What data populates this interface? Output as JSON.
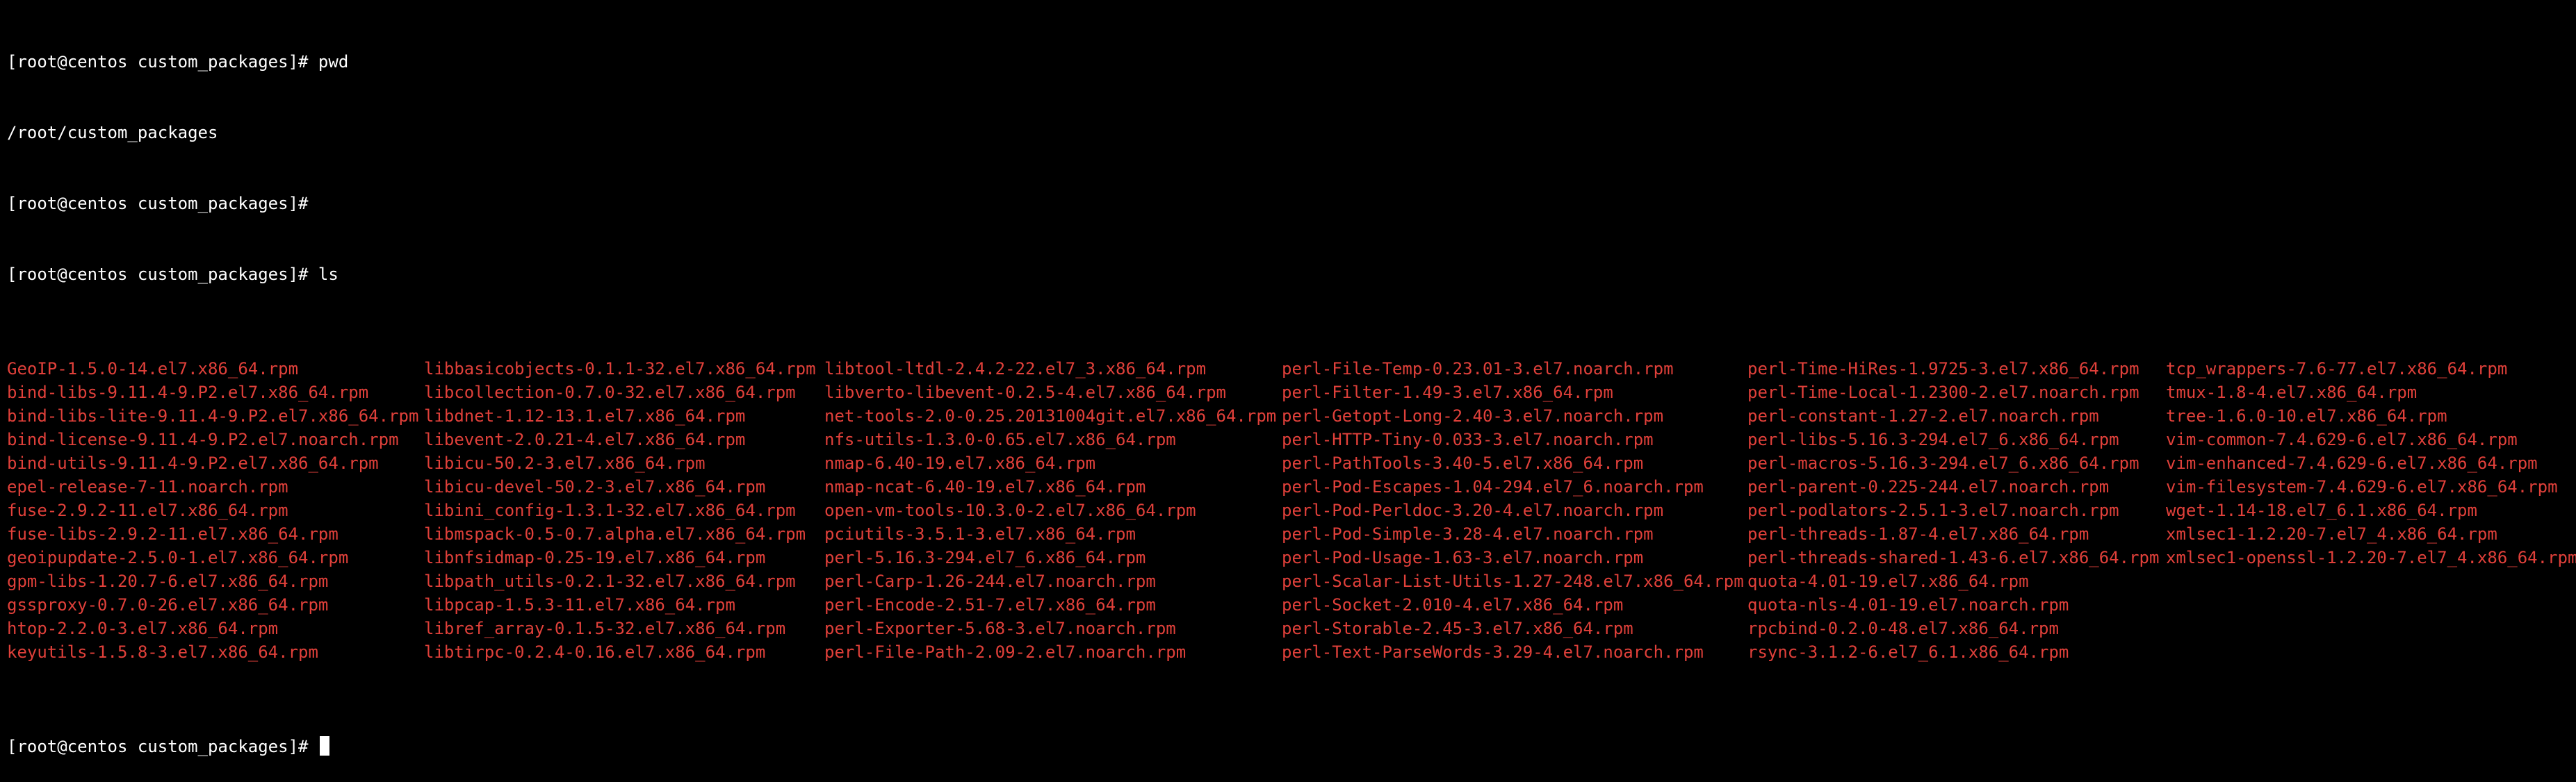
{
  "colors": {
    "background": "#000000",
    "text": "#ffffff",
    "rpm_file": "#e0403a"
  },
  "lines": {
    "cmd1": "[root@centos custom_packages]# pwd",
    "out1": "/root/custom_packages",
    "cmd2": "[root@centos custom_packages]#",
    "cmd3": "[root@centos custom_packages]# ls",
    "prompt": "[root@centos custom_packages]# "
  },
  "ls_columns": [
    [
      "GeoIP-1.5.0-14.el7.x86_64.rpm",
      "bind-libs-9.11.4-9.P2.el7.x86_64.rpm",
      "bind-libs-lite-9.11.4-9.P2.el7.x86_64.rpm",
      "bind-license-9.11.4-9.P2.el7.noarch.rpm",
      "bind-utils-9.11.4-9.P2.el7.x86_64.rpm",
      "epel-release-7-11.noarch.rpm",
      "fuse-2.9.2-11.el7.x86_64.rpm",
      "fuse-libs-2.9.2-11.el7.x86_64.rpm",
      "geoipupdate-2.5.0-1.el7.x86_64.rpm",
      "gpm-libs-1.20.7-6.el7.x86_64.rpm",
      "gssproxy-0.7.0-26.el7.x86_64.rpm",
      "htop-2.2.0-3.el7.x86_64.rpm",
      "keyutils-1.5.8-3.el7.x86_64.rpm"
    ],
    [
      "libbasicobjects-0.1.1-32.el7.x86_64.rpm",
      "libcollection-0.7.0-32.el7.x86_64.rpm",
      "libdnet-1.12-13.1.el7.x86_64.rpm",
      "libevent-2.0.21-4.el7.x86_64.rpm",
      "libicu-50.2-3.el7.x86_64.rpm",
      "libicu-devel-50.2-3.el7.x86_64.rpm",
      "libini_config-1.3.1-32.el7.x86_64.rpm",
      "libmspack-0.5-0.7.alpha.el7.x86_64.rpm",
      "libnfsidmap-0.25-19.el7.x86_64.rpm",
      "libpath_utils-0.2.1-32.el7.x86_64.rpm",
      "libpcap-1.5.3-11.el7.x86_64.rpm",
      "libref_array-0.1.5-32.el7.x86_64.rpm",
      "libtirpc-0.2.4-0.16.el7.x86_64.rpm"
    ],
    [
      "libtool-ltdl-2.4.2-22.el7_3.x86_64.rpm",
      "libverto-libevent-0.2.5-4.el7.x86_64.rpm",
      "net-tools-2.0-0.25.20131004git.el7.x86_64.rpm",
      "nfs-utils-1.3.0-0.65.el7.x86_64.rpm",
      "nmap-6.40-19.el7.x86_64.rpm",
      "nmap-ncat-6.40-19.el7.x86_64.rpm",
      "open-vm-tools-10.3.0-2.el7.x86_64.rpm",
      "pciutils-3.5.1-3.el7.x86_64.rpm",
      "perl-5.16.3-294.el7_6.x86_64.rpm",
      "perl-Carp-1.26-244.el7.noarch.rpm",
      "perl-Encode-2.51-7.el7.x86_64.rpm",
      "perl-Exporter-5.68-3.el7.noarch.rpm",
      "perl-File-Path-2.09-2.el7.noarch.rpm"
    ],
    [
      "perl-File-Temp-0.23.01-3.el7.noarch.rpm",
      "perl-Filter-1.49-3.el7.x86_64.rpm",
      "perl-Getopt-Long-2.40-3.el7.noarch.rpm",
      "perl-HTTP-Tiny-0.033-3.el7.noarch.rpm",
      "perl-PathTools-3.40-5.el7.x86_64.rpm",
      "perl-Pod-Escapes-1.04-294.el7_6.noarch.rpm",
      "perl-Pod-Perldoc-3.20-4.el7.noarch.rpm",
      "perl-Pod-Simple-3.28-4.el7.noarch.rpm",
      "perl-Pod-Usage-1.63-3.el7.noarch.rpm",
      "perl-Scalar-List-Utils-1.27-248.el7.x86_64.rpm",
      "perl-Socket-2.010-4.el7.x86_64.rpm",
      "perl-Storable-2.45-3.el7.x86_64.rpm",
      "perl-Text-ParseWords-3.29-4.el7.noarch.rpm"
    ],
    [
      "perl-Time-HiRes-1.9725-3.el7.x86_64.rpm",
      "perl-Time-Local-1.2300-2.el7.noarch.rpm",
      "perl-constant-1.27-2.el7.noarch.rpm",
      "perl-libs-5.16.3-294.el7_6.x86_64.rpm",
      "perl-macros-5.16.3-294.el7_6.x86_64.rpm",
      "perl-parent-0.225-244.el7.noarch.rpm",
      "perl-podlators-2.5.1-3.el7.noarch.rpm",
      "perl-threads-1.87-4.el7.x86_64.rpm",
      "perl-threads-shared-1.43-6.el7.x86_64.rpm",
      "quota-4.01-19.el7.x86_64.rpm",
      "quota-nls-4.01-19.el7.noarch.rpm",
      "rpcbind-0.2.0-48.el7.x86_64.rpm",
      "rsync-3.1.2-6.el7_6.1.x86_64.rpm"
    ],
    [
      "tcp_wrappers-7.6-77.el7.x86_64.rpm",
      "tmux-1.8-4.el7.x86_64.rpm",
      "tree-1.6.0-10.el7.x86_64.rpm",
      "vim-common-7.4.629-6.el7.x86_64.rpm",
      "vim-enhanced-7.4.629-6.el7.x86_64.rpm",
      "vim-filesystem-7.4.629-6.el7.x86_64.rpm",
      "wget-1.14-18.el7_6.1.x86_64.rpm",
      "xmlsec1-1.2.20-7.el7_4.x86_64.rpm",
      "xmlsec1-openssl-1.2.20-7.el7_4.x86_64.rpm"
    ]
  ]
}
